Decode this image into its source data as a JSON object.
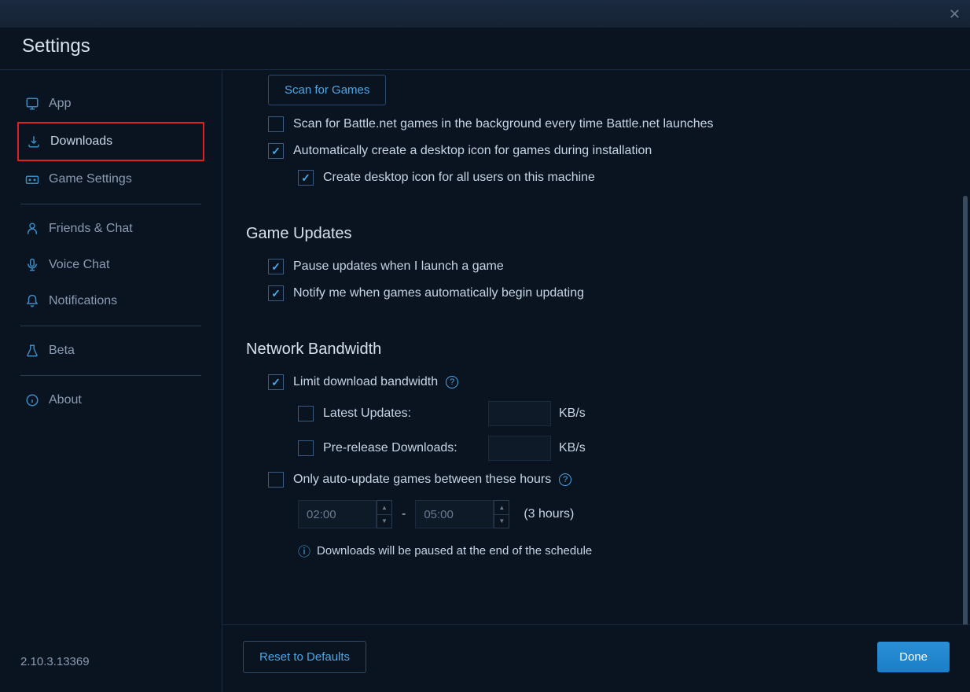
{
  "header": {
    "title": "Settings"
  },
  "sidebar": {
    "items": [
      {
        "label": "App"
      },
      {
        "label": "Downloads"
      },
      {
        "label": "Game Settings"
      },
      {
        "label": "Friends & Chat"
      },
      {
        "label": "Voice Chat"
      },
      {
        "label": "Notifications"
      },
      {
        "label": "Beta"
      },
      {
        "label": "About"
      }
    ]
  },
  "version": "2.10.3.13369",
  "content": {
    "scan_button": "Scan for Games",
    "scan_background": "Scan for Battle.net games in the background every time Battle.net launches",
    "auto_desktop_icon": "Automatically create a desktop icon for games during installation",
    "desktop_icon_all_users": "Create desktop icon for all users on this machine",
    "game_updates_title": "Game Updates",
    "pause_updates": "Pause updates when I launch a game",
    "notify_updates": "Notify me when games automatically begin updating",
    "bandwidth_title": "Network Bandwidth",
    "limit_bandwidth": "Limit download bandwidth",
    "latest_updates": "Latest Updates:",
    "prerelease": "Pre-release Downloads:",
    "kbps": "KB/s",
    "auto_update_hours": "Only auto-update games between these hours",
    "time_start": "02:00",
    "time_end": "05:00",
    "duration": "(3 hours)",
    "schedule_info": "Downloads will be paused at the end of the schedule"
  },
  "footer": {
    "reset": "Reset to Defaults",
    "done": "Done"
  }
}
